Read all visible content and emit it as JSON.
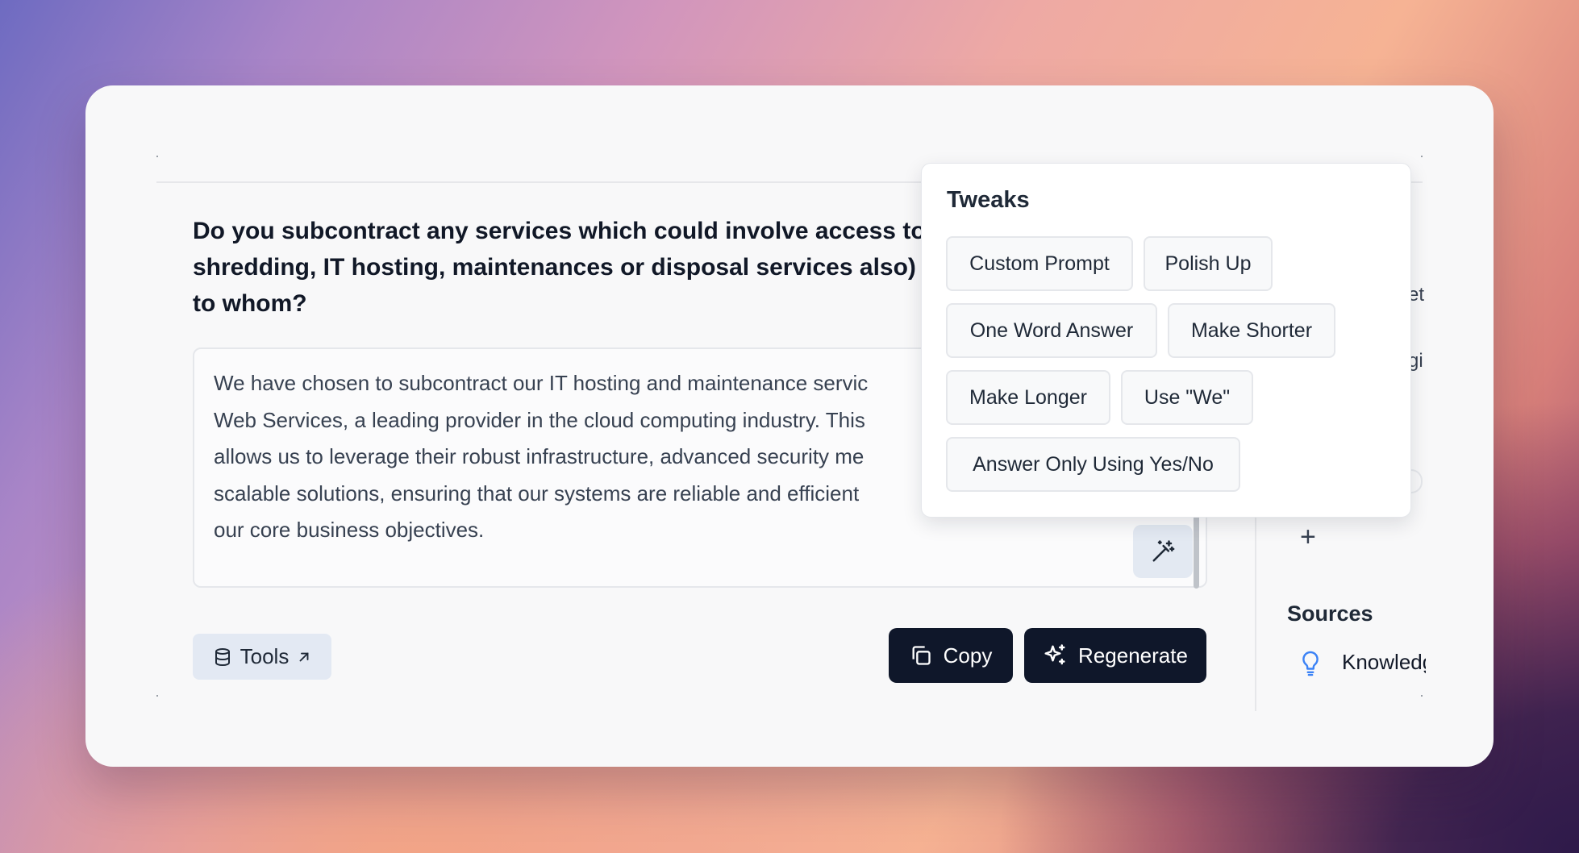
{
  "question": {
    "lines": [
      "Do you subcontract any services which could involve access to",
      "shredding, IT hosting, maintenances or disposal services also)",
      "to whom?"
    ]
  },
  "answer": {
    "lines": [
      "We have chosen to subcontract our IT hosting and maintenance servic",
      "Web Services, a leading provider in the cloud computing industry. This",
      "allows us to leverage their robust infrastructure, advanced security me",
      "scalable solutions, ensuring that our systems are reliable and efficient",
      "our core business objectives."
    ]
  },
  "toolbar": {
    "tools_label": "Tools",
    "copy_label": "Copy",
    "regenerate_label": "Regenerate"
  },
  "tweaks": {
    "title": "Tweaks",
    "options": [
      "Custom Prompt",
      "Polish Up",
      "One Word Answer",
      "Make Shorter",
      "Make Longer",
      "Use \"We\"",
      "Answer Only Using Yes/No"
    ]
  },
  "side_panel": {
    "peek_1": "et",
    "peek_2": "gi",
    "add_symbol": "+",
    "sources_heading": "Sources",
    "source_item": "Knowledge"
  },
  "icons": {
    "wand": "wand-sparkles-icon",
    "tools": "database-icon",
    "external": "arrow-up-right-icon",
    "copy": "copy-icon",
    "regenerate": "sparkles-icon",
    "bulb": "lightbulb-icon"
  },
  "colors": {
    "primary_button": "#0f172a",
    "accent_blue": "#3b82f6"
  }
}
